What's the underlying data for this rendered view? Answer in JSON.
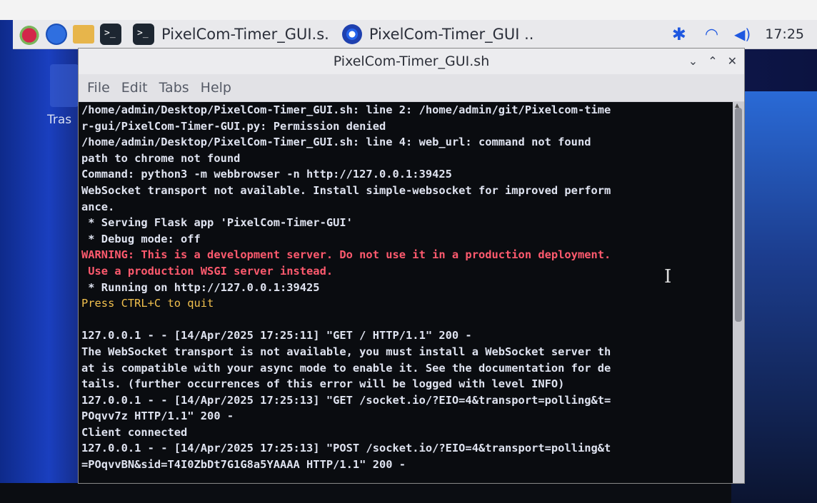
{
  "taskbar": {
    "tasks": [
      {
        "label": "PixelCom-Timer_GUI.s."
      },
      {
        "label": "PixelCom-Timer_GUI .."
      }
    ],
    "clock": "17:25"
  },
  "desktop": {
    "trash_label": "Tras"
  },
  "window": {
    "title": "PixelCom-Timer_GUI.sh",
    "controls": [
      "⌄",
      "⌃",
      "✕"
    ],
    "menu": [
      "File",
      "Edit",
      "Tabs",
      "Help"
    ]
  },
  "terminal": {
    "lines": [
      {
        "text": "/home/admin/Desktop/PixelCom-Timer_GUI.sh: line 2: /home/admin/git/Pixelcom-time",
        "style": "normal"
      },
      {
        "text": "r-gui/PixelCom-Timer-GUI.py: Permission denied",
        "style": "normal"
      },
      {
        "text": "/home/admin/Desktop/PixelCom-Timer_GUI.sh: line 4: web_url: command not found",
        "style": "normal"
      },
      {
        "text": "path to chrome not found",
        "style": "normal"
      },
      {
        "text": "Command: python3 -m webbrowser -n http://127.0.0.1:39425",
        "style": "normal"
      },
      {
        "text": "WebSocket transport not available. Install simple-websocket for improved perform",
        "style": "normal"
      },
      {
        "text": "ance.",
        "style": "normal"
      },
      {
        "text": " * Serving Flask app 'PixelCom-Timer-GUI'",
        "style": "normal"
      },
      {
        "text": " * Debug mode: off",
        "style": "normal"
      },
      {
        "text": "WARNING: This is a development server. Do not use it in a production deployment.",
        "style": "warn"
      },
      {
        "text": " Use a production WSGI server instead.",
        "style": "warn"
      },
      {
        "text": " * Running on http://127.0.0.1:39425",
        "style": "normal"
      },
      {
        "text": "Press CTRL+C to quit",
        "style": "yellow"
      },
      {
        "text": " ",
        "style": "normal"
      },
      {
        "text": "127.0.0.1 - - [14/Apr/2025 17:25:11] \"GET / HTTP/1.1\" 200 -",
        "style": "normal"
      },
      {
        "text": "The WebSocket transport is not available, you must install a WebSocket server th",
        "style": "normal"
      },
      {
        "text": "at is compatible with your async mode to enable it. See the documentation for de",
        "style": "normal"
      },
      {
        "text": "tails. (further occurrences of this error will be logged with level INFO)",
        "style": "normal"
      },
      {
        "text": "127.0.0.1 - - [14/Apr/2025 17:25:13] \"GET /socket.io/?EIO=4&transport=polling&t=",
        "style": "normal"
      },
      {
        "text": "POqvv7z HTTP/1.1\" 200 -",
        "style": "normal"
      },
      {
        "text": "Client connected",
        "style": "normal"
      },
      {
        "text": "127.0.0.1 - - [14/Apr/2025 17:25:13] \"POST /socket.io/?EIO=4&transport=polling&t",
        "style": "normal"
      },
      {
        "text": "=POqvvBN&sid=T4I0ZbDt7G1G8a5YAAAA HTTP/1.1\" 200 -",
        "style": "normal"
      }
    ]
  }
}
